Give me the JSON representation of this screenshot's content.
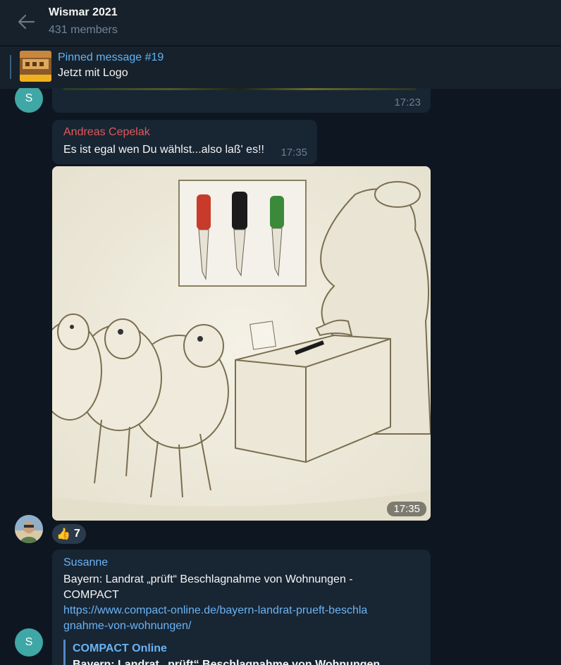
{
  "header": {
    "title": "Wismar 2021",
    "members": "431 members"
  },
  "pinned": {
    "title": "Pinned message #19",
    "text": "Jetzt mit Logo"
  },
  "messages": [
    {
      "avatar_letter": "S",
      "time": "17:23"
    },
    {
      "sender": "Andreas Cepelak",
      "sender_color": "#e1595a",
      "text": "Es ist egal wen Du wählst...also laß' es!!",
      "time": "17:35"
    },
    {
      "image_time": "17:35",
      "reaction_emoji": "👍",
      "reaction_count": "7"
    },
    {
      "sender": "Susanne",
      "sender_color": "#6ab3f3",
      "avatar_letter": "S",
      "text": "Bayern: Landrat „prüft“ Beschlagnahme von Wohnungen - COMPACT",
      "link": "https://www.compact-online.de/bayern-landrat-prueft-beschlagnahme-von-wohnungen/",
      "preview_site": "COMPACT Online",
      "preview_title": "Bayern: Landrat „prüft“ Beschlagnahme von Wohnungen"
    }
  ]
}
